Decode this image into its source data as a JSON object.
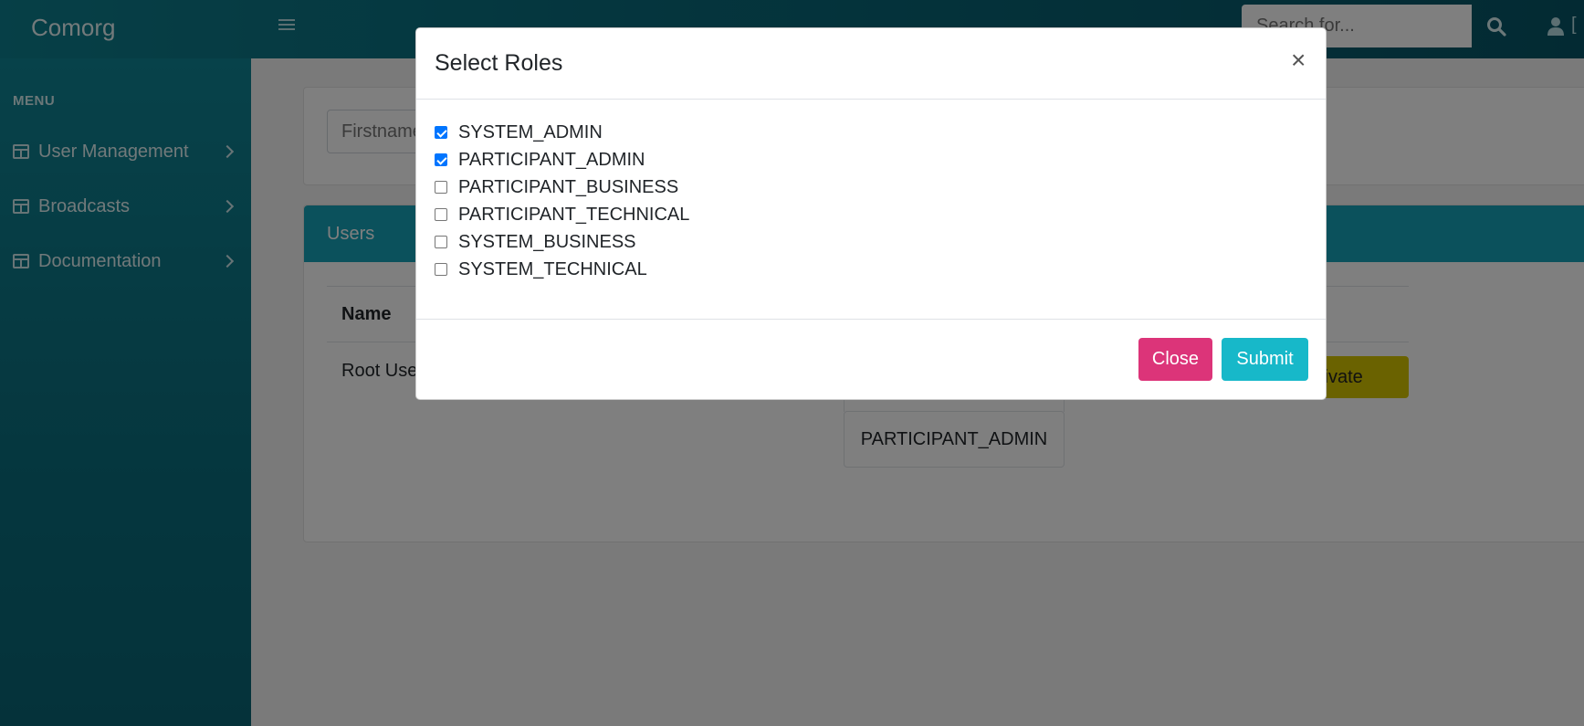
{
  "app": {
    "brand": "Comorg"
  },
  "topbar": {
    "search_placeholder": "Search for..."
  },
  "sidebar": {
    "menu_heading": "MENU",
    "items": [
      {
        "label": "User Management"
      },
      {
        "label": "Broadcasts"
      },
      {
        "label": "Documentation"
      }
    ]
  },
  "main": {
    "firstname_placeholder": "Firstname",
    "users_title": "Users",
    "table": {
      "header_name": "Name",
      "rows": [
        {
          "name": "Root User",
          "role": "PARTICIPANT_ADMIN",
          "action": "ctivate"
        }
      ]
    }
  },
  "modal": {
    "title": "Select Roles",
    "close_symbol": "×",
    "roles": [
      {
        "label": "SYSTEM_ADMIN",
        "checked": true
      },
      {
        "label": "PARTICIPANT_ADMIN",
        "checked": true
      },
      {
        "label": "PARTICIPANT_BUSINESS",
        "checked": false
      },
      {
        "label": "PARTICIPANT_TECHNICAL",
        "checked": false
      },
      {
        "label": "SYSTEM_BUSINESS",
        "checked": false
      },
      {
        "label": "SYSTEM_TECHNICAL",
        "checked": false
      }
    ],
    "close_label": "Close",
    "submit_label": "Submit"
  },
  "colors": {
    "accent": "#17a2b8",
    "close_button": "#dc3479",
    "submit_button": "#17b8c9",
    "activate_button": "#d4c400"
  }
}
